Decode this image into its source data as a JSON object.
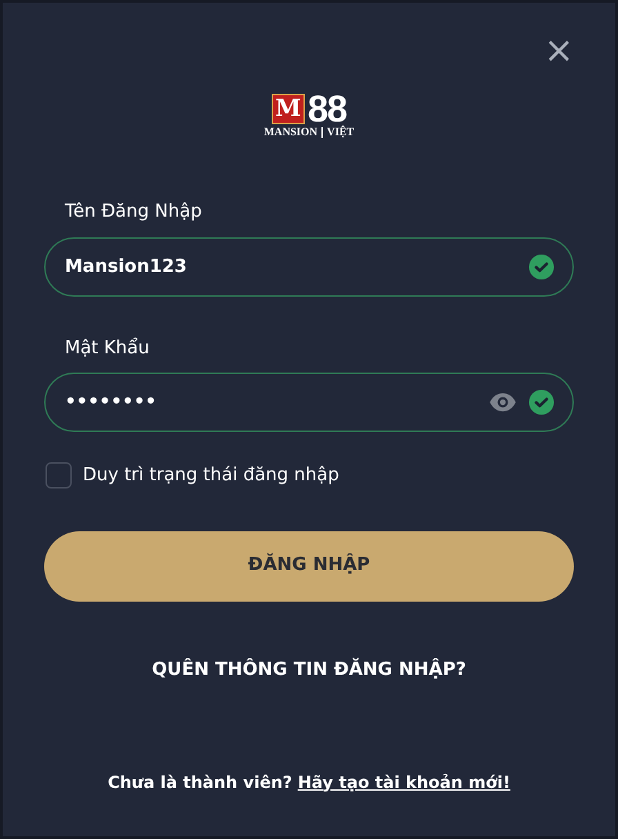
{
  "close": "×",
  "logo": {
    "mark": "M",
    "number": "88",
    "brand": "MANSION",
    "region": "VIỆT"
  },
  "fields": [
    {
      "label": "Tên Đăng Nhập",
      "value": "Mansion123",
      "valid": true,
      "kind": "text"
    },
    {
      "label": "Mật Khẩu",
      "value": "••••••••",
      "valid": true,
      "kind": "password"
    }
  ],
  "remember": {
    "label": "Duy trì trạng thái đăng nhập",
    "checked": false
  },
  "login_button": "ĐĂNG NHẬP",
  "forgot_link": "QUÊN THÔNG TIN ĐĂNG NHẬP?",
  "footer": {
    "text": "Chưa là thành viên?",
    "link": "Hãy tạo tài khoản mới!"
  }
}
